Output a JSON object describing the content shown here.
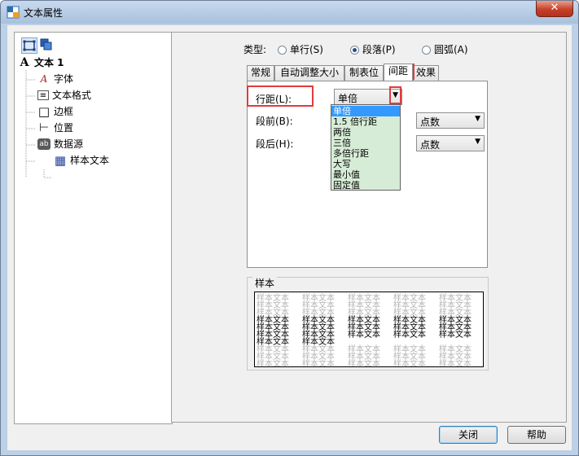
{
  "window": {
    "title": "文本属性",
    "close_label": "✕"
  },
  "left_panel": {
    "tree": [
      {
        "label": "文本 1",
        "icon": "text-object-icon",
        "glyph": "A",
        "bold": true
      },
      {
        "label": "字体",
        "icon": "font-icon",
        "glyph": "A"
      },
      {
        "label": "文本格式",
        "icon": "text-format-icon",
        "glyph": "≡"
      },
      {
        "label": "边框",
        "icon": "border-icon",
        "glyph": "□"
      },
      {
        "label": "位置",
        "icon": "position-icon",
        "glyph": "⊢"
      },
      {
        "label": "数据源",
        "icon": "data-source-icon",
        "glyph": "ab"
      },
      {
        "label": "样本文本",
        "icon": "sample-text-icon",
        "glyph": "▦"
      }
    ]
  },
  "type_row": {
    "label": "类型:",
    "options": [
      {
        "label": "单行(S)",
        "checked": false
      },
      {
        "label": "段落(P)",
        "checked": true
      },
      {
        "label": "圆弧(A)",
        "checked": false
      }
    ]
  },
  "tabs": [
    "常规",
    "自动调整大小",
    "制表位",
    "间距",
    "效果"
  ],
  "active_tab": "间距",
  "spacing": {
    "line_spacing_label": "行距(L):",
    "line_spacing_value": "单倍",
    "before_label": "段前(B):",
    "before_unit": "点数",
    "after_label": "段后(H):",
    "after_unit": "点数",
    "dropdown_options": [
      "单倍",
      "1.5 倍行距",
      "两倍",
      "三倍",
      "多倍行距",
      "大写",
      "最小值",
      "固定值"
    ]
  },
  "sample": {
    "title": "样本",
    "word": "样本文本",
    "lines": [
      {
        "style": "ghost"
      },
      {
        "style": "ghost"
      },
      {
        "style": "ghost"
      },
      {
        "style": "dark"
      },
      {
        "style": "dark"
      },
      {
        "style": "dark"
      },
      {
        "style": "dark"
      },
      {
        "style": "ghost"
      },
      {
        "style": "ghost"
      },
      {
        "style": "ghost"
      }
    ]
  },
  "buttons": {
    "close": "关闭",
    "help": "帮助"
  },
  "colors": {
    "highlight": "#e23b3b",
    "dropdown_bg": "#d6ecd6",
    "selection": "#3399ff"
  }
}
